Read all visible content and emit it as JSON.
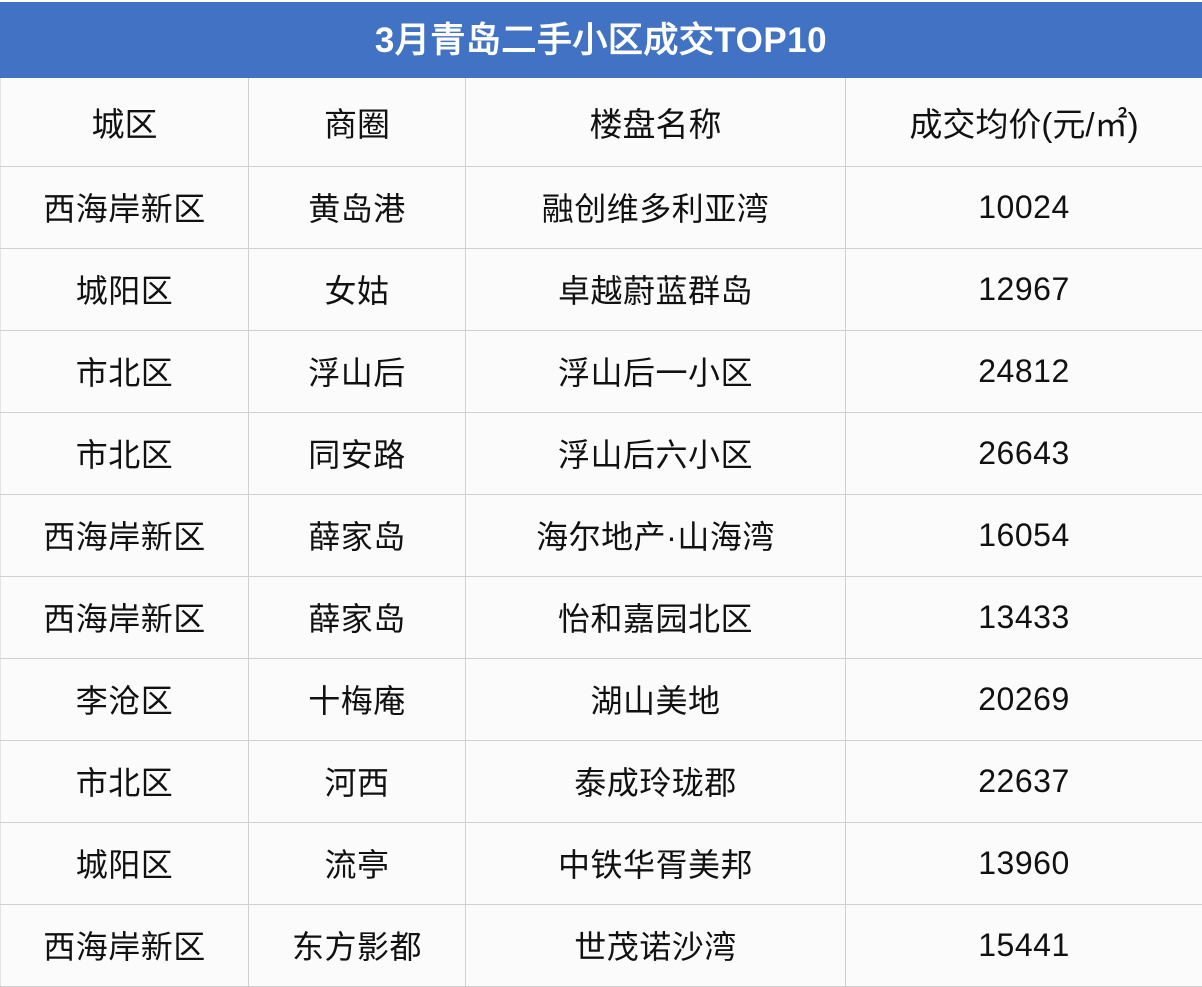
{
  "title": "3月青岛二手小区成交TOP10",
  "theme": {
    "banner_color": "#4172c4",
    "banner_text_color": "#ffffff",
    "cell_background": "#fbfbfb",
    "grid_line_color": "#d0d0d0",
    "text_color": "#111111"
  },
  "table": {
    "columns": [
      {
        "key": "district",
        "label": "城区"
      },
      {
        "key": "area",
        "label": "商圈"
      },
      {
        "key": "estate",
        "label": "楼盘名称"
      },
      {
        "key": "price",
        "label": "成交均价(元/㎡)"
      }
    ],
    "rows": [
      {
        "district": "西海岸新区",
        "area": "黄岛港",
        "estate": "融创维多利亚湾",
        "price": "10024"
      },
      {
        "district": "城阳区",
        "area": "女姑",
        "estate": "卓越蔚蓝群岛",
        "price": "12967"
      },
      {
        "district": "市北区",
        "area": "浮山后",
        "estate": "浮山后一小区",
        "price": "24812"
      },
      {
        "district": "市北区",
        "area": "同安路",
        "estate": "浮山后六小区",
        "price": "26643"
      },
      {
        "district": "西海岸新区",
        "area": "薛家岛",
        "estate": "海尔地产·山海湾",
        "price": "16054"
      },
      {
        "district": "西海岸新区",
        "area": "薛家岛",
        "estate": "怡和嘉园北区",
        "price": "13433"
      },
      {
        "district": "李沧区",
        "area": "十梅庵",
        "estate": "湖山美地",
        "price": "20269"
      },
      {
        "district": "市北区",
        "area": "河西",
        "estate": "泰成玲珑郡",
        "price": "22637"
      },
      {
        "district": "城阳区",
        "area": "流亭",
        "estate": "中铁华胥美邦",
        "price": "13960"
      },
      {
        "district": "西海岸新区",
        "area": "东方影都",
        "estate": "世茂诺沙湾",
        "price": "15441"
      }
    ]
  },
  "chart_data": {
    "type": "table",
    "title": "3月青岛二手小区成交TOP10",
    "columns": [
      "城区",
      "商圈",
      "楼盘名称",
      "成交均价(元/㎡)"
    ],
    "rows": [
      [
        "西海岸新区",
        "黄岛港",
        "融创维多利亚湾",
        10024
      ],
      [
        "城阳区",
        "女姑",
        "卓越蔚蓝群岛",
        12967
      ],
      [
        "市北区",
        "浮山后",
        "浮山后一小区",
        24812
      ],
      [
        "市北区",
        "同安路",
        "浮山后六小区",
        26643
      ],
      [
        "西海岸新区",
        "薛家岛",
        "海尔地产·山海湾",
        16054
      ],
      [
        "西海岸新区",
        "薛家岛",
        "怡和嘉园北区",
        13433
      ],
      [
        "李沧区",
        "十梅庵",
        "湖山美地",
        20269
      ],
      [
        "市北区",
        "河西",
        "泰成玲珑郡",
        22637
      ],
      [
        "城阳区",
        "流亭",
        "中铁华胥美邦",
        13960
      ],
      [
        "西海岸新区",
        "东方影都",
        "世茂诺沙湾",
        15441
      ]
    ],
    "value_column": "成交均价(元/㎡)",
    "values": [
      10024,
      12967,
      24812,
      26643,
      16054,
      13433,
      20269,
      22637,
      13960,
      15441
    ],
    "units": "元/㎡"
  }
}
